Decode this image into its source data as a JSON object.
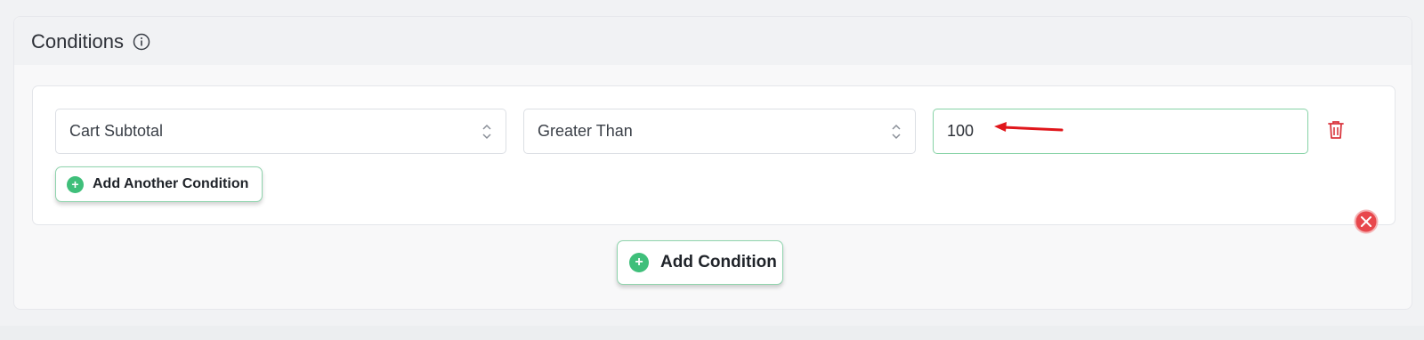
{
  "panel": {
    "title": "Conditions",
    "info_icon": "info-circle-icon"
  },
  "condition_row": {
    "field_select": {
      "value": "Cart Subtotal",
      "icon": "chevron-updown-icon"
    },
    "operator_select": {
      "value": "Greater Than",
      "icon": "chevron-updown-icon"
    },
    "value_input": {
      "value": "100"
    },
    "delete_icon": "trash-icon",
    "annotation": "red-arrow-icon"
  },
  "add_another_label": "Add Another Condition",
  "add_condition_label": "Add Condition",
  "remove_group_icon": "close-circle-icon",
  "colors": {
    "accent_green": "#3fbf7a",
    "active_border": "#86d2a6",
    "danger_red": "#d9363e"
  }
}
